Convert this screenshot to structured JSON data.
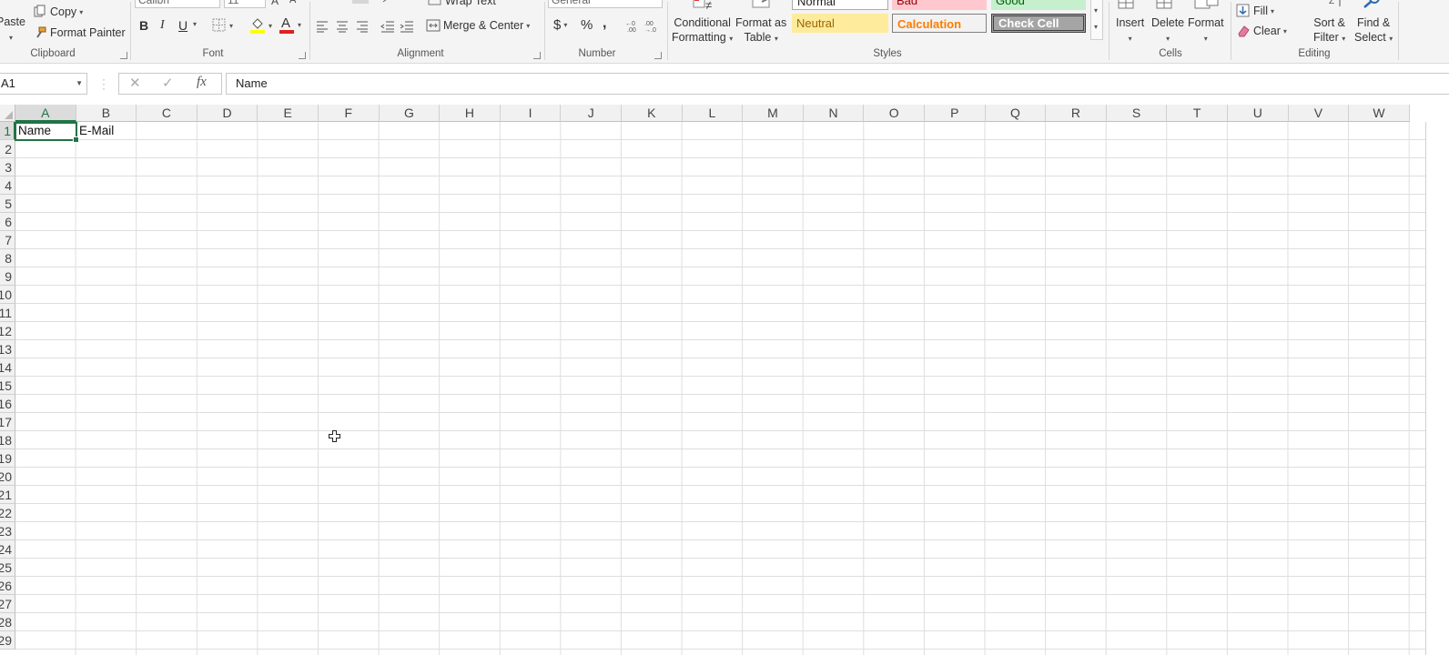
{
  "ribbon": {
    "clipboard": {
      "paste_label": "Paste",
      "copy_label": "Copy",
      "format_painter_label": "Format Painter",
      "group_label": "Clipboard"
    },
    "font": {
      "font_name": "Calibri",
      "font_size": "11",
      "group_label": "Font"
    },
    "alignment": {
      "wrap_text_label": "Wrap Text",
      "merge_center_label": "Merge & Center",
      "group_label": "Alignment"
    },
    "number": {
      "format_value": "General",
      "currency_symbol": "$",
      "percent_symbol": "%",
      "comma_symbol": ",",
      "group_label": "Number"
    },
    "styles": {
      "conditional_formatting_line1": "Conditional",
      "conditional_formatting_line2": "Formatting",
      "format_as_table_line1": "Format as",
      "format_as_table_line2": "Table",
      "normal_label": "Normal",
      "bad_label": "Bad",
      "good_label": "Good",
      "neutral_label": "Neutral",
      "calculation_label": "Calculation",
      "check_cell_label": "Check Cell",
      "group_label": "Styles"
    },
    "cells": {
      "insert_label": "Insert",
      "delete_label": "Delete",
      "format_label": "Format",
      "group_label": "Cells"
    },
    "editing": {
      "fill_label": "Fill",
      "clear_label": "Clear",
      "sort_filter_line1": "Sort &",
      "sort_filter_line2": "Filter",
      "find_select_line1": "Find &",
      "find_select_line2": "Select",
      "group_label": "Editing"
    }
  },
  "formula_bar": {
    "name_box": "A1",
    "fx_label": "fx",
    "formula_value": "Name"
  },
  "columns": [
    "A",
    "B",
    "C",
    "D",
    "E",
    "F",
    "G",
    "H",
    "I",
    "J",
    "K",
    "L",
    "M",
    "N",
    "O",
    "P",
    "Q",
    "R",
    "S",
    "T",
    "U",
    "V",
    "W"
  ],
  "rows": [
    "1",
    "2",
    "3",
    "4",
    "5",
    "6",
    "7",
    "8",
    "9",
    "10",
    "11",
    "12",
    "13",
    "14",
    "15",
    "16",
    "17",
    "18",
    "19",
    "20",
    "21",
    "22",
    "23",
    "24",
    "25",
    "26",
    "27",
    "28",
    "29"
  ],
  "cells": {
    "A1": "Name",
    "B1": "E-Mail"
  },
  "selected_cell": "A1",
  "colors": {
    "accent": "#217346",
    "neutral_bg": "#ffeb9c",
    "neutral_fg": "#9c6500",
    "bad_bg": "#ffc7ce",
    "good_bg": "#c6efce",
    "calc_fg": "#fa7d00",
    "check_bg": "#a5a5a5"
  }
}
